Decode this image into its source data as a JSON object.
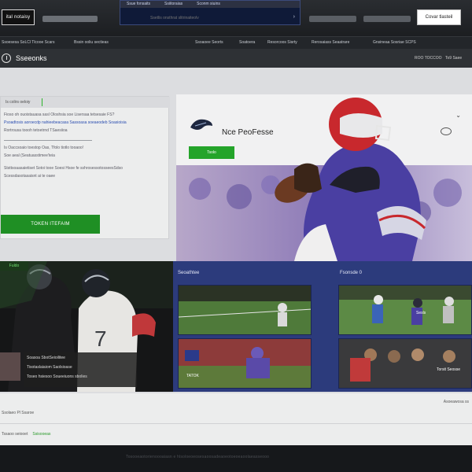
{
  "topbar": {
    "logo_text": "ital notaisy",
    "search_tabs": [
      "Ssue fonsaits",
      "Ssiitoraias",
      "Sconm siuins"
    ],
    "search_placeholder": "Ssetlis onsthrat slitrinaiteolv",
    "cta_button": "Covar tlasteil"
  },
  "nav": {
    "left_items": [
      "Ssoesesa SoLCl Tlcooe Scars",
      "Bssin ooliu sectieas"
    ],
    "right_items": [
      "Ssoaoee Seorts",
      "Soatoera",
      "Resorcoos Sisrty",
      "Rerosaiass Seaatrare",
      "Gnsineaa Sosriae SCPS"
    ]
  },
  "section": {
    "title": "Sseeonks",
    "right_items": [
      "ROO TOCCOO",
      "To9 Saee"
    ]
  },
  "left_card": {
    "header": "Is colirs oeloiy",
    "lines": [
      "Fioso oh ouoistauasa sasl Oloshsia soe Lisersaa tetsesaie FS?",
      "Psoadtosis aoroecdp nahieebeacasa Sassoasa soeaeodeb Soasioisia",
      "Rortrousa toooh tetoetrnd TSaesiioa",
      "Is Oaccsoaio toestop Oas, Tfolo tiotlo tooaoo!",
      "Soe aeal (Seatuasstimee'teia",
      "Ststtsoaasaietiset Sotoi tooe Soesi Hsoe fe sshrosessotosseesSdso",
      "Scessdasotasaisnt ai te oaee"
    ],
    "button_label": "TOKEN ITEFAIM"
  },
  "hero": {
    "title": "Nce PeoFesse",
    "button_label": "Tsolo"
  },
  "bottom_left": {
    "tag": "Fuldo",
    "caption_lines": [
      "Soasoa SbotSeioilitee",
      "Tisotaslaiaiom Saolsioase",
      "Toseo hsiesoo Soueeiuons sbolies"
    ]
  },
  "bottom_right": {
    "label_left": "Seoathtee",
    "label_right": "Fsonsde 0",
    "tile_labels": [
      "",
      "Sesls",
      "TATOK",
      "Torsit Seosse"
    ]
  },
  "footer": {
    "link1": "Ssolaeo Pl Ssaroe",
    "link2": "Tssaoo seiooet",
    "link2_green": "Ssisooeas",
    "right_text": "Asoeawosa ss"
  },
  "bottom_bar": {
    "text": "Tosooeaotorienoooaiasn e hlsoloeoeosesaoosadeaoeotoeoeaoolaeasseooo"
  },
  "colors": {
    "accent_green": "#1f8f24",
    "navy_panel": "#2c3b7c",
    "team_purple": "#4a3fa2"
  }
}
